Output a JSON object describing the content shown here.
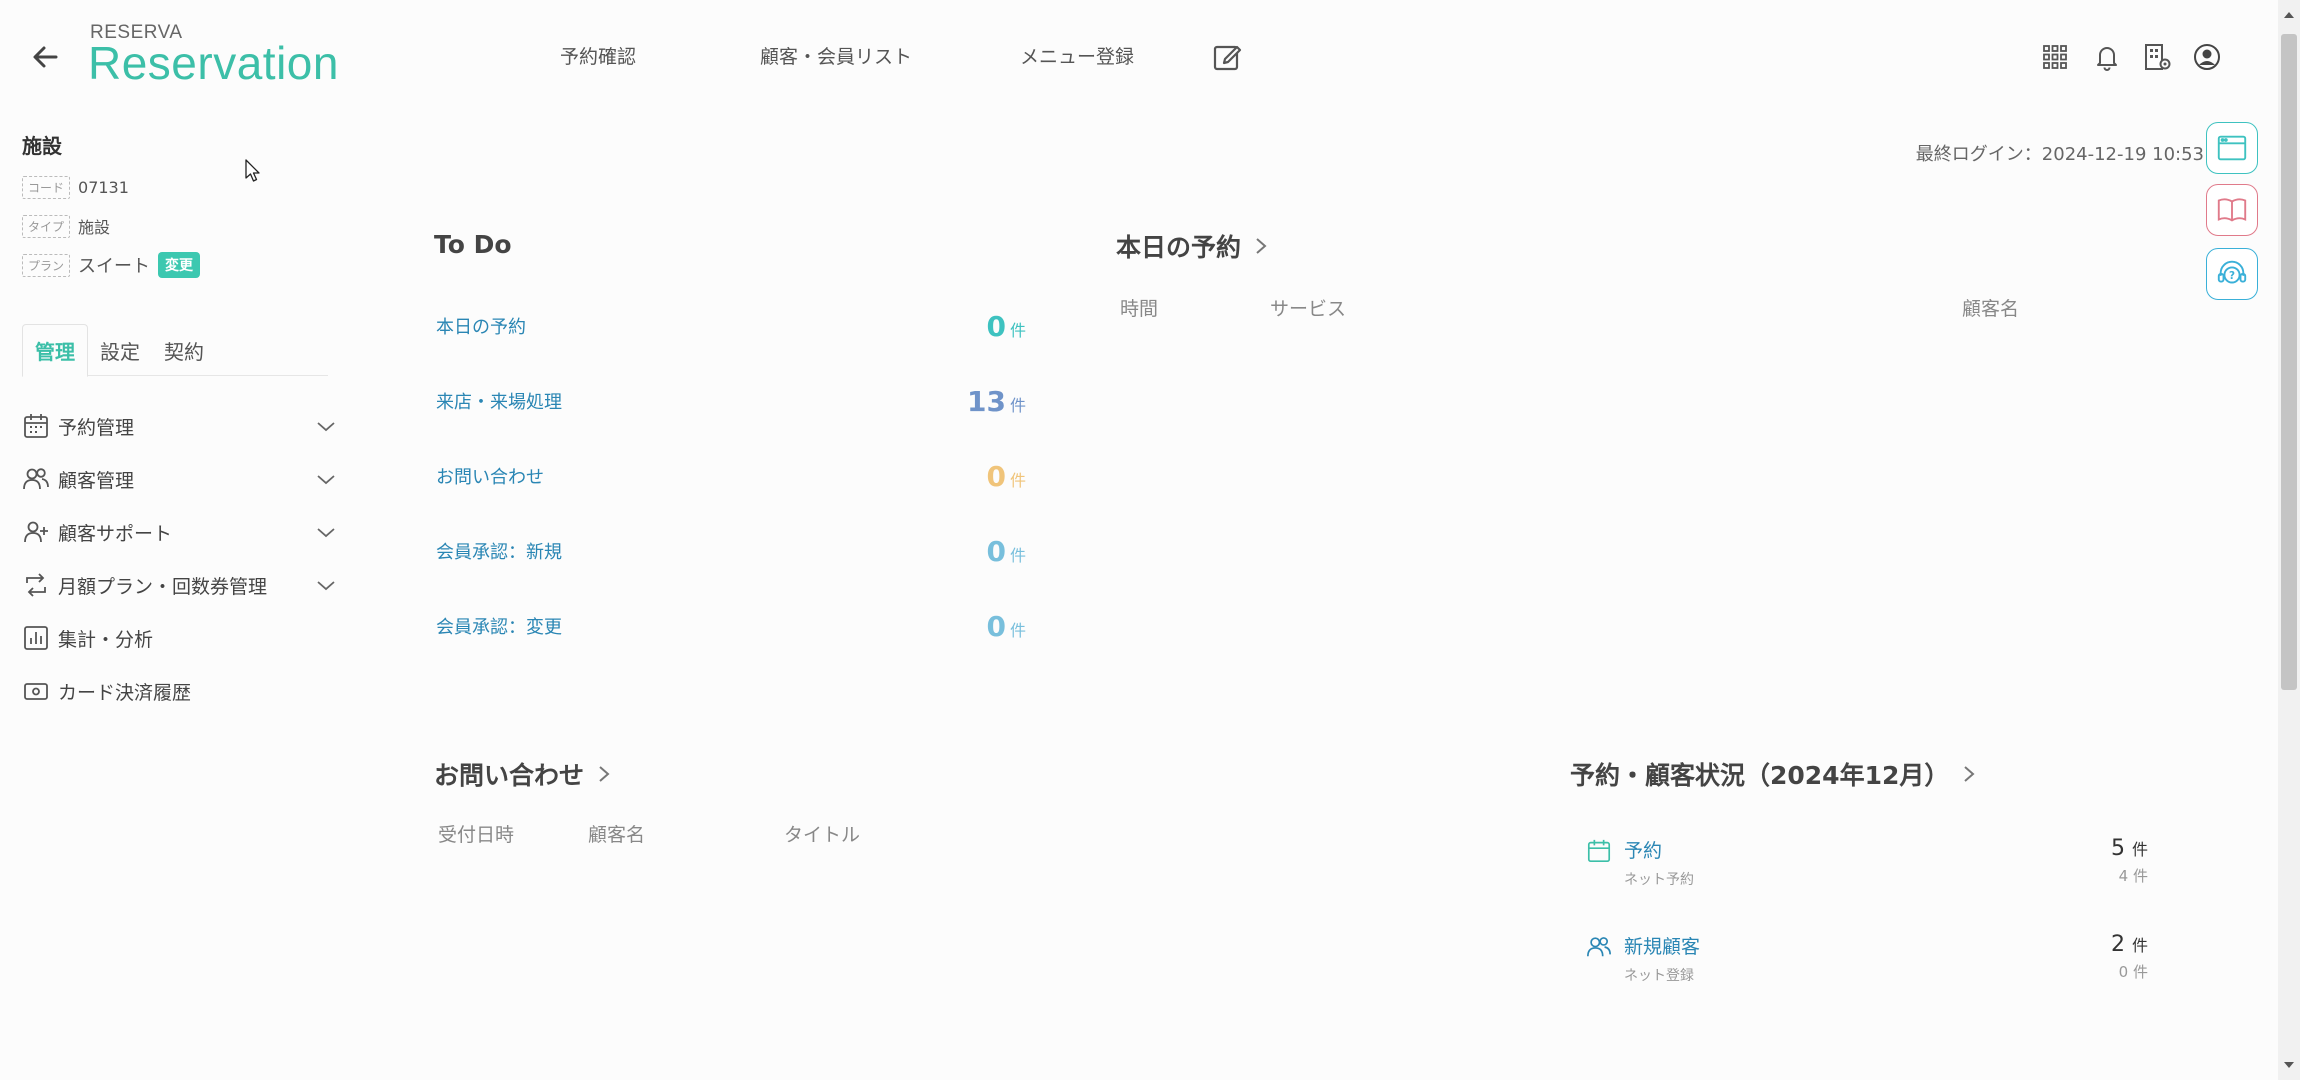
{
  "header": {
    "brand_small": "RESERVA",
    "brand_big": "Reservation",
    "nav": [
      "予約確認",
      "顧客・会員リスト",
      "メニュー登録"
    ],
    "icons": [
      "apps-grid-icon",
      "bell-icon",
      "building-settings-icon",
      "user-account-icon"
    ]
  },
  "sidebar": {
    "facility_title": "施設",
    "code_tag": "コード",
    "code_value": "07131",
    "type_tag": "タイプ",
    "type_value": "施設",
    "plan_tag": "プラン",
    "plan_value": "スイート",
    "change_label": "変更",
    "tabs": [
      "管理",
      "設定",
      "契約"
    ],
    "active_tab": "管理",
    "items": [
      {
        "label": "予約管理",
        "icon": "calendar-icon",
        "expandable": true
      },
      {
        "label": "顧客管理",
        "icon": "users-icon",
        "expandable": true
      },
      {
        "label": "顧客サポート",
        "icon": "user-plus-icon",
        "expandable": true
      },
      {
        "label": "月額プラン・回数券管理",
        "icon": "repeat-icon",
        "expandable": true
      },
      {
        "label": "集計・分析",
        "icon": "bar-chart-icon",
        "expandable": false
      },
      {
        "label": "カード決済履歴",
        "icon": "card-icon",
        "expandable": false
      }
    ]
  },
  "main": {
    "last_login": "最終ログイン：2024-12-19 10:53",
    "todo": {
      "title": "To Do",
      "rows": [
        {
          "label": "本日の予約",
          "count": "0",
          "unit": "件",
          "color": "#3ec2c0"
        },
        {
          "label": "来店・来場処理",
          "count": "13",
          "unit": "件",
          "color": "#6f93c9"
        },
        {
          "label": "お問い合わせ",
          "count": "0",
          "unit": "件",
          "color": "#f0c47a"
        },
        {
          "label": "会員承認：新規",
          "count": "0",
          "unit": "件",
          "color": "#78bfdc"
        },
        {
          "label": "会員承認：変更",
          "count": "0",
          "unit": "件",
          "color": "#78bfdc"
        }
      ]
    },
    "today": {
      "title": "本日の予約",
      "columns": [
        "時間",
        "サービス",
        "顧客名"
      ]
    },
    "inquiry": {
      "title": "お問い合わせ",
      "columns": [
        "受付日時",
        "顧客名",
        "タイトル"
      ]
    },
    "status": {
      "title": "予約・顧客状況（2024年12月）",
      "rows": [
        {
          "label": "予約",
          "sub": "ネット予約",
          "count": "5",
          "unit": "件",
          "sub_count": "4",
          "sub_unit": "件",
          "icon": "calendar-icon"
        },
        {
          "label": "新規顧客",
          "sub": "ネット登録",
          "count": "2",
          "unit": "件",
          "sub_count": "0",
          "sub_unit": "件",
          "icon": "users-icon"
        }
      ]
    }
  },
  "colors": {
    "brand": "#3cbfa8",
    "link": "#2a86b4",
    "fab_browser": "#3ec2c0",
    "fab_book": "#e07a8a",
    "fab_support": "#3ab0d8"
  }
}
